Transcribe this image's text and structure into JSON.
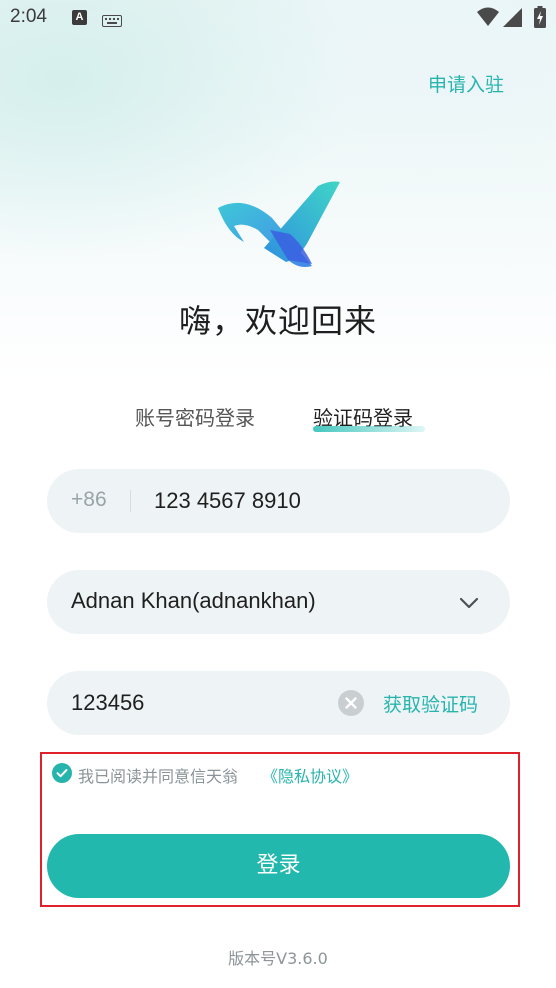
{
  "status_bar": {
    "time": "2:04",
    "notification_letter": "A",
    "icons": [
      "text-notification-icon",
      "keyboard-icon",
      "wifi-icon",
      "signal-icon",
      "battery-icon"
    ]
  },
  "header": {
    "apply_link": "申请入驻"
  },
  "welcome": "嗨，欢迎回来",
  "tabs": [
    {
      "label": "账号密码登录",
      "active": false
    },
    {
      "label": "验证码登录",
      "active": true
    }
  ],
  "phone": {
    "country_code": "+86",
    "value": "123 4567 8910"
  },
  "account": {
    "selected": "Adnan Khan(adnankhan)"
  },
  "code": {
    "value": "123456",
    "get_code_label": "获取验证码"
  },
  "agreement": {
    "checked": true,
    "text": "我已阅读并同意信天翁",
    "link": "《隐私协议》"
  },
  "login_label": "登录",
  "version": "版本号V3.6.0",
  "colors": {
    "accent": "#22b8ad",
    "field_bg": "#eef3f6",
    "highlight": "#e0202a"
  }
}
